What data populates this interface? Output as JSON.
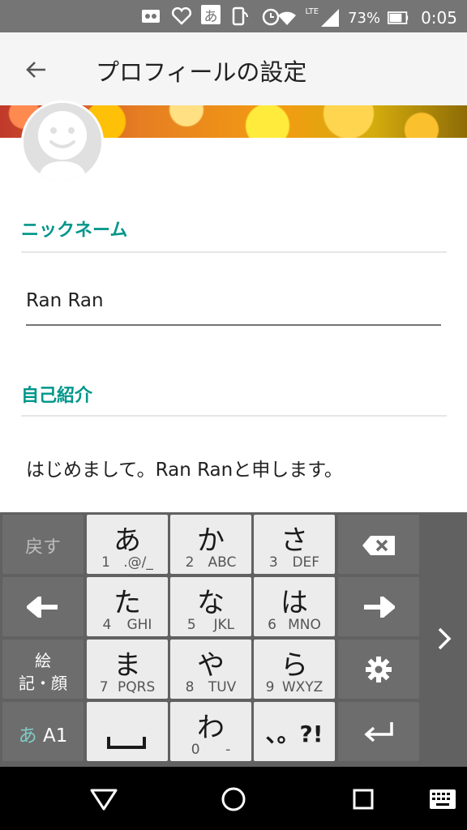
{
  "status_bar": {
    "battery": "73%",
    "time": "0:05",
    "network": "LTE",
    "ime_indicator": "あ",
    "icons": [
      "voicemail-icon",
      "heart-icon",
      "ime-icon",
      "nfc-icon",
      "alarm-icon",
      "wifi-icon",
      "signal-icon",
      "battery-icon"
    ]
  },
  "appbar": {
    "title": "プロフィールの設定",
    "back_icon": "arrow-left-icon"
  },
  "profile": {
    "nickname_label": "ニックネーム",
    "nickname_value": "Ran Ran",
    "bio_label": "自己紹介",
    "bio_value": "はじめまして。Ran Ranと申します。"
  },
  "keyboard": {
    "left_keys": {
      "undo": "戻す",
      "emoji_line1": "絵",
      "emoji_line2": "記・顔",
      "mode_kana": "あ",
      "mode_alnum": "A1"
    },
    "keys": [
      {
        "main": "あ",
        "num": "1",
        "letters": ".@/_"
      },
      {
        "main": "か",
        "num": "2",
        "letters": "ABC"
      },
      {
        "main": "さ",
        "num": "3",
        "letters": "DEF"
      },
      {
        "main": "た",
        "num": "4",
        "letters": "GHI"
      },
      {
        "main": "な",
        "num": "5",
        "letters": "JKL"
      },
      {
        "main": "は",
        "num": "6",
        "letters": "MNO"
      },
      {
        "main": "ま",
        "num": "7",
        "letters": "PQRS"
      },
      {
        "main": "や",
        "num": "8",
        "letters": "TUV"
      },
      {
        "main": "ら",
        "num": "9",
        "letters": "WXYZ"
      },
      {
        "main": "わ",
        "num": "0",
        "letters": "-"
      }
    ],
    "punct_key": "、。?!",
    "right_icons": [
      "backspace-icon",
      "arrow-right-icon",
      "gear-icon",
      "enter-icon"
    ],
    "left_icons": [
      "arrow-left-icon"
    ],
    "space_icon": "space-icon",
    "expand_icon": "chevron-right-icon"
  },
  "nav_bar": {
    "icons": [
      "back-triangle-icon",
      "home-circle-icon",
      "recents-square-icon",
      "keyboard-icon"
    ]
  },
  "colors": {
    "accent": "#00968a",
    "status_bar": "#757575",
    "keyboard_bg": "#616161"
  }
}
